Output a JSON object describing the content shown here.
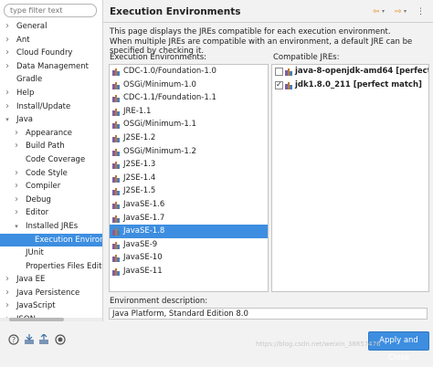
{
  "filter": {
    "placeholder": "type filter text"
  },
  "tree": [
    {
      "label": "General",
      "level": 0,
      "arrow": "closed"
    },
    {
      "label": "Ant",
      "level": 0,
      "arrow": "closed"
    },
    {
      "label": "Cloud Foundry",
      "level": 0,
      "arrow": "closed"
    },
    {
      "label": "Data Management",
      "level": 0,
      "arrow": "closed"
    },
    {
      "label": "Gradle",
      "level": 0,
      "arrow": "none"
    },
    {
      "label": "Help",
      "level": 0,
      "arrow": "closed"
    },
    {
      "label": "Install/Update",
      "level": 0,
      "arrow": "closed"
    },
    {
      "label": "Java",
      "level": 0,
      "arrow": "open"
    },
    {
      "label": "Appearance",
      "level": 1,
      "arrow": "closed"
    },
    {
      "label": "Build Path",
      "level": 1,
      "arrow": "closed"
    },
    {
      "label": "Code Coverage",
      "level": 1,
      "arrow": "none"
    },
    {
      "label": "Code Style",
      "level": 1,
      "arrow": "closed"
    },
    {
      "label": "Compiler",
      "level": 1,
      "arrow": "closed"
    },
    {
      "label": "Debug",
      "level": 1,
      "arrow": "closed"
    },
    {
      "label": "Editor",
      "level": 1,
      "arrow": "closed"
    },
    {
      "label": "Installed JREs",
      "level": 1,
      "arrow": "open"
    },
    {
      "label": "Execution Environm",
      "level": 2,
      "arrow": "none",
      "selected": true
    },
    {
      "label": "JUnit",
      "level": 1,
      "arrow": "none"
    },
    {
      "label": "Properties Files Editor",
      "level": 1,
      "arrow": "none"
    },
    {
      "label": "Java EE",
      "level": 0,
      "arrow": "closed"
    },
    {
      "label": "Java Persistence",
      "level": 0,
      "arrow": "closed"
    },
    {
      "label": "JavaScript",
      "level": 0,
      "arrow": "closed"
    },
    {
      "label": "JSON",
      "level": 0,
      "arrow": "closed"
    }
  ],
  "header": {
    "title": "Execution Environments",
    "back_icon": "⇦",
    "forward_icon": "⇨",
    "menu_icon": "⋮"
  },
  "description": {
    "line1": "This page displays the JREs compatible for each execution environment.",
    "line2": "When multiple JREs are compatible with an environment, a default JRE can be specified by checking it."
  },
  "exec_env": {
    "label": "Execution Environments:",
    "items": [
      "CDC-1.0/Foundation-1.0",
      "OSGi/Minimum-1.0",
      "CDC-1.1/Foundation-1.1",
      "JRE-1.1",
      "OSGi/Minimum-1.1",
      "J2SE-1.2",
      "OSGi/Minimum-1.2",
      "J2SE-1.3",
      "J2SE-1.4",
      "J2SE-1.5",
      "JavaSE-1.6",
      "JavaSE-1.7",
      "JavaSE-1.8",
      "JavaSE-9",
      "JavaSE-10",
      "JavaSE-11"
    ],
    "selected_index": 12
  },
  "compatible": {
    "label": "Compatible JREs:",
    "items": [
      {
        "label": "java-8-openjdk-amd64 [perfect match]",
        "checked": false
      },
      {
        "label": "jdk1.8.0_211 [perfect match]",
        "checked": true
      }
    ]
  },
  "env_description": {
    "label": "Environment description:",
    "value": "Java Platform, Standard Edition 8.0"
  },
  "bottom": {
    "apply_close": "Apply and Close",
    "icons": [
      "help-icon",
      "import-icon",
      "export-icon",
      "record-icon"
    ]
  },
  "watermark": "https://blog.csdn.net/weixin_38857476"
}
